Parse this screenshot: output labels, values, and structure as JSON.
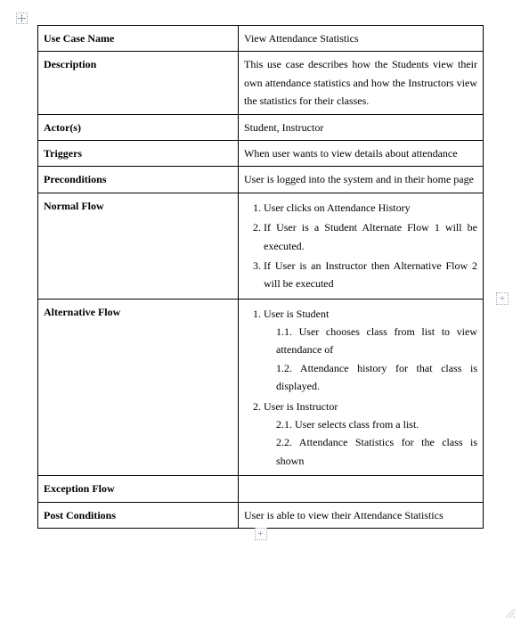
{
  "table": {
    "rows": [
      {
        "label": "Use Case Name",
        "value": "View Attendance Statistics"
      },
      {
        "label": "Description",
        "value": "This use case describes how the Students view their own attendance statistics and how the Instructors view the statistics for their classes."
      },
      {
        "label": "Actor(s)",
        "value": "Student, Instructor"
      },
      {
        "label": "Triggers",
        "value": "When user wants to view details about attendance"
      },
      {
        "label": "Preconditions",
        "value": "User is logged into the system and in their home page"
      },
      {
        "label": "Normal Flow",
        "normal_flow": [
          "User clicks on Attendance History",
          "If User is a Student Alternate Flow 1 will be executed.",
          "If User is an Instructor then Alternative Flow 2 will be executed"
        ]
      },
      {
        "label": "Alternative Flow",
        "alt_flow": {
          "group1_title": "User is Student",
          "group1_items": [
            "1.1. User chooses class from list to view attendance of",
            "1.2. Attendance history for that class is displayed."
          ],
          "group2_title": "User is Instructor",
          "group2_items": [
            "2.1. User selects class from a list.",
            "2.2. Attendance Statistics for the class is shown"
          ]
        }
      },
      {
        "label": "Exception Flow",
        "value": ""
      },
      {
        "label": "Post Conditions",
        "value": "User is able to view their Attendance Statistics"
      }
    ]
  },
  "controls": {
    "add_row_label": "+",
    "add_col_label": "+"
  }
}
